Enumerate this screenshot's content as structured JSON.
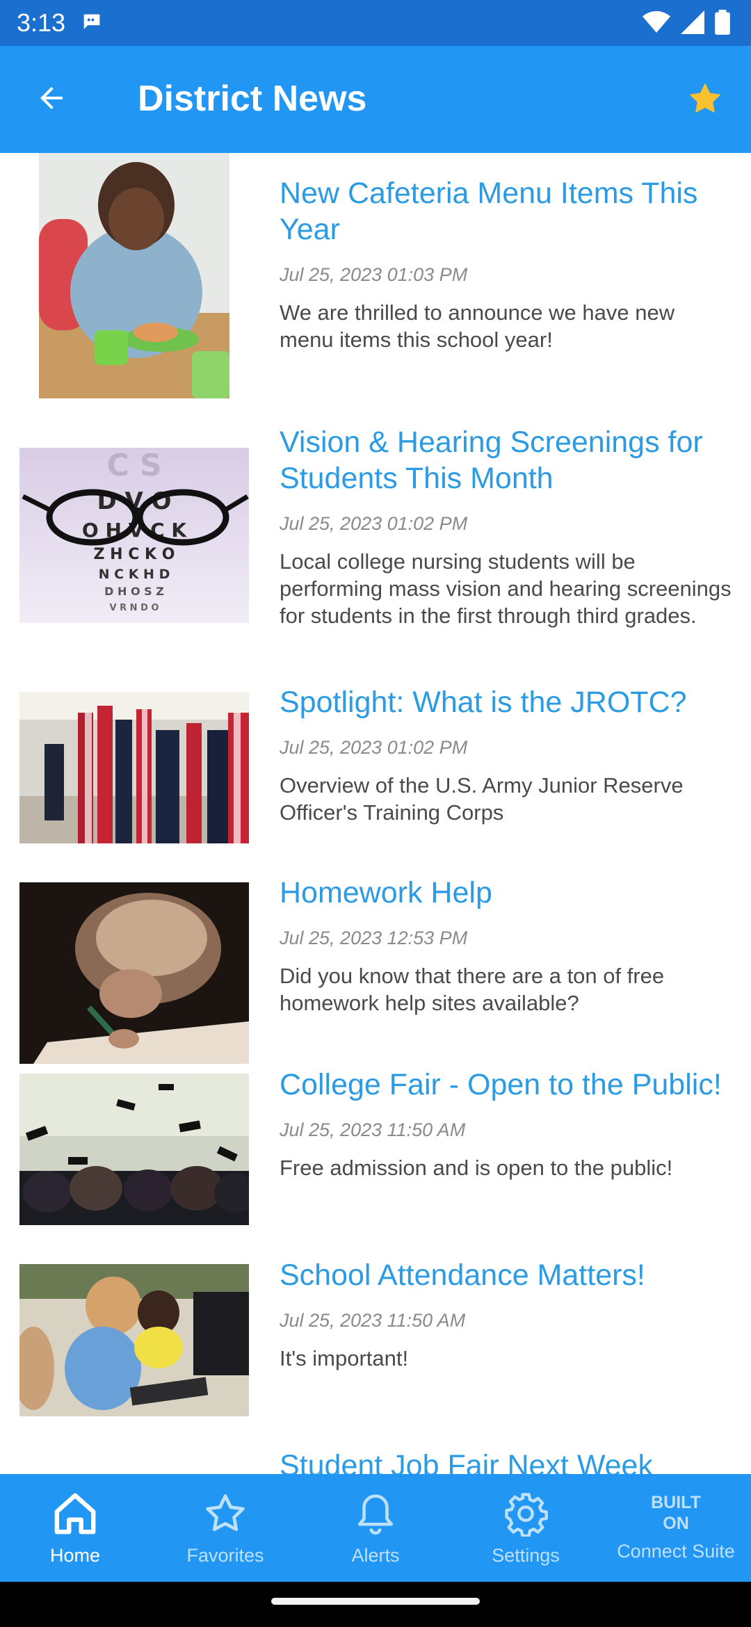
{
  "status_bar": {
    "time": "3:13"
  },
  "app_bar": {
    "title": "District News"
  },
  "news_items": [
    {
      "title": "New Cafeteria Menu Items This Year",
      "date": "Jul 25, 2023  01:03 PM",
      "description": "We are thrilled to announce we have new menu items this school year!",
      "image": "child-eating-lunch"
    },
    {
      "title": "Vision & Hearing Screenings for Students This Month",
      "date": "Jul 25, 2023  01:02 PM",
      "description": "Local college nursing students will be performing mass vision and hearing screenings for students in the first through third grades.",
      "image": "glasses-on-eye-chart",
      "eye_chart_rows": [
        "C S",
        "D V O",
        "O H V C K",
        "Z H C K O",
        "N C K H D",
        "D H O S Z",
        "V R N D O"
      ]
    },
    {
      "title": "Spotlight: What is the JROTC?",
      "date": "Jul 25, 2023  01:02 PM",
      "description": "Overview of the U.S. Army Junior Reserve Officer's Training Corps",
      "image": "flags-in-hallway"
    },
    {
      "title": "Homework Help",
      "date": "Jul 25, 2023  12:53 PM",
      "description": "Did you know that there are a ton of free homework help sites available?",
      "image": "child-writing"
    },
    {
      "title": "College Fair - Open to the Public!",
      "date": "Jul 25, 2023  11:50 AM",
      "description": "Free admission and is open to the public!",
      "image": "graduation-caps"
    },
    {
      "title": "School Attendance Matters!",
      "date": "Jul 25, 2023  11:50 AM",
      "description": "It's important!",
      "image": "kids-at-computers"
    },
    {
      "title": "Student Job Fair Next Week",
      "date": "",
      "description": "",
      "image": ""
    }
  ],
  "bottom_nav": {
    "items": [
      {
        "label": "Home",
        "icon": "home-icon",
        "active": true
      },
      {
        "label": "Favorites",
        "icon": "star-icon",
        "active": false
      },
      {
        "label": "Alerts",
        "icon": "bell-icon",
        "active": false
      },
      {
        "label": "Settings",
        "icon": "gear-icon",
        "active": false
      }
    ],
    "built_on": {
      "line1": "BUILT",
      "line2": "ON",
      "label": "Connect Suite"
    }
  },
  "colors": {
    "status_bar": "#1a6fcf",
    "app_bar": "#2196f3",
    "title_link": "#2b9be3",
    "favorite_star": "#fbc02d"
  }
}
